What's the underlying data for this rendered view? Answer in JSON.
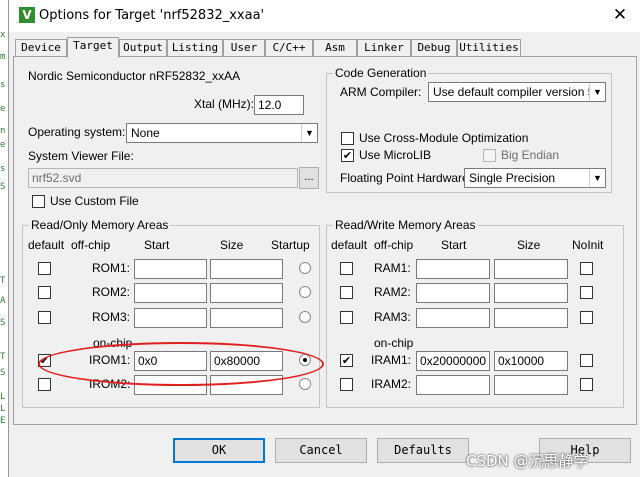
{
  "window": {
    "title": "Options for Target 'nrf52832_xxaa'",
    "icon": "uvision-icon",
    "close_glyph": "✕"
  },
  "tabs": [
    "Device",
    "Target",
    "Output",
    "Listing",
    "User",
    "C/C++",
    "Asm",
    "Linker",
    "Debug",
    "Utilities"
  ],
  "active_tab": "Target",
  "device": {
    "name": "Nordic Semiconductor nRF52832_xxAA",
    "xtal_label": "Xtal (MHz):",
    "xtal_value": "12.0",
    "os_label": "Operating system:",
    "os_value": "None",
    "svd_label": "System Viewer File:",
    "svd_value": "nrf52.svd",
    "svd_browse": "...",
    "custom_file_label": "Use Custom File"
  },
  "codegen": {
    "title": "Code Generation",
    "compiler_label": "ARM Compiler:",
    "compiler_value": "Use default compiler version 5",
    "cross_module_label": "Use Cross-Module Optimization",
    "microlib_label": "Use MicroLIB",
    "big_endian_label": "Big Endian",
    "fp_label": "Floating Point Hardware:",
    "fp_value": "Single Precision"
  },
  "rom": {
    "title": "Read/Only Memory Areas",
    "headers": {
      "default": "default",
      "offchip": "off-chip",
      "start": "Start",
      "size": "Size",
      "startup": "Startup"
    },
    "onchip_label": "on-chip",
    "rows": [
      {
        "name": "ROM1:",
        "start": "",
        "size": "",
        "default": false,
        "startup": false
      },
      {
        "name": "ROM2:",
        "start": "",
        "size": "",
        "default": false,
        "startup": false
      },
      {
        "name": "ROM3:",
        "start": "",
        "size": "",
        "default": false,
        "startup": false
      },
      {
        "name": "IROM1:",
        "start": "0x0",
        "size": "0x80000",
        "default": true,
        "startup": true
      },
      {
        "name": "IROM2:",
        "start": "",
        "size": "",
        "default": false,
        "startup": false
      }
    ]
  },
  "ram": {
    "title": "Read/Write Memory Areas",
    "headers": {
      "default": "default",
      "offchip": "off-chip",
      "start": "Start",
      "size": "Size",
      "noinit": "NoInit"
    },
    "onchip_label": "on-chip",
    "rows": [
      {
        "name": "RAM1:",
        "start": "",
        "size": "",
        "default": false,
        "noinit": false
      },
      {
        "name": "RAM2:",
        "start": "",
        "size": "",
        "default": false,
        "noinit": false
      },
      {
        "name": "RAM3:",
        "start": "",
        "size": "",
        "default": false,
        "noinit": false
      },
      {
        "name": "IRAM1:",
        "start": "0x20000000",
        "size": "0x10000",
        "default": true,
        "noinit": false
      },
      {
        "name": "IRAM2:",
        "start": "",
        "size": "",
        "default": false,
        "noinit": false
      }
    ]
  },
  "buttons": {
    "ok": "OK",
    "cancel": "Cancel",
    "defaults": "Defaults",
    "help": "Help"
  },
  "watermark": "CSDN @沉思静学",
  "background_letters": [
    "x",
    "m",
    "s",
    "e",
    "n",
    "e",
    "s",
    "S",
    "T",
    "A",
    "S",
    "T",
    "S",
    "L",
    "L",
    "E"
  ],
  "colors": {
    "annotation": "#e02020",
    "dialog_bg": "#f0f0f0",
    "default_button_border": "#0078d7"
  }
}
